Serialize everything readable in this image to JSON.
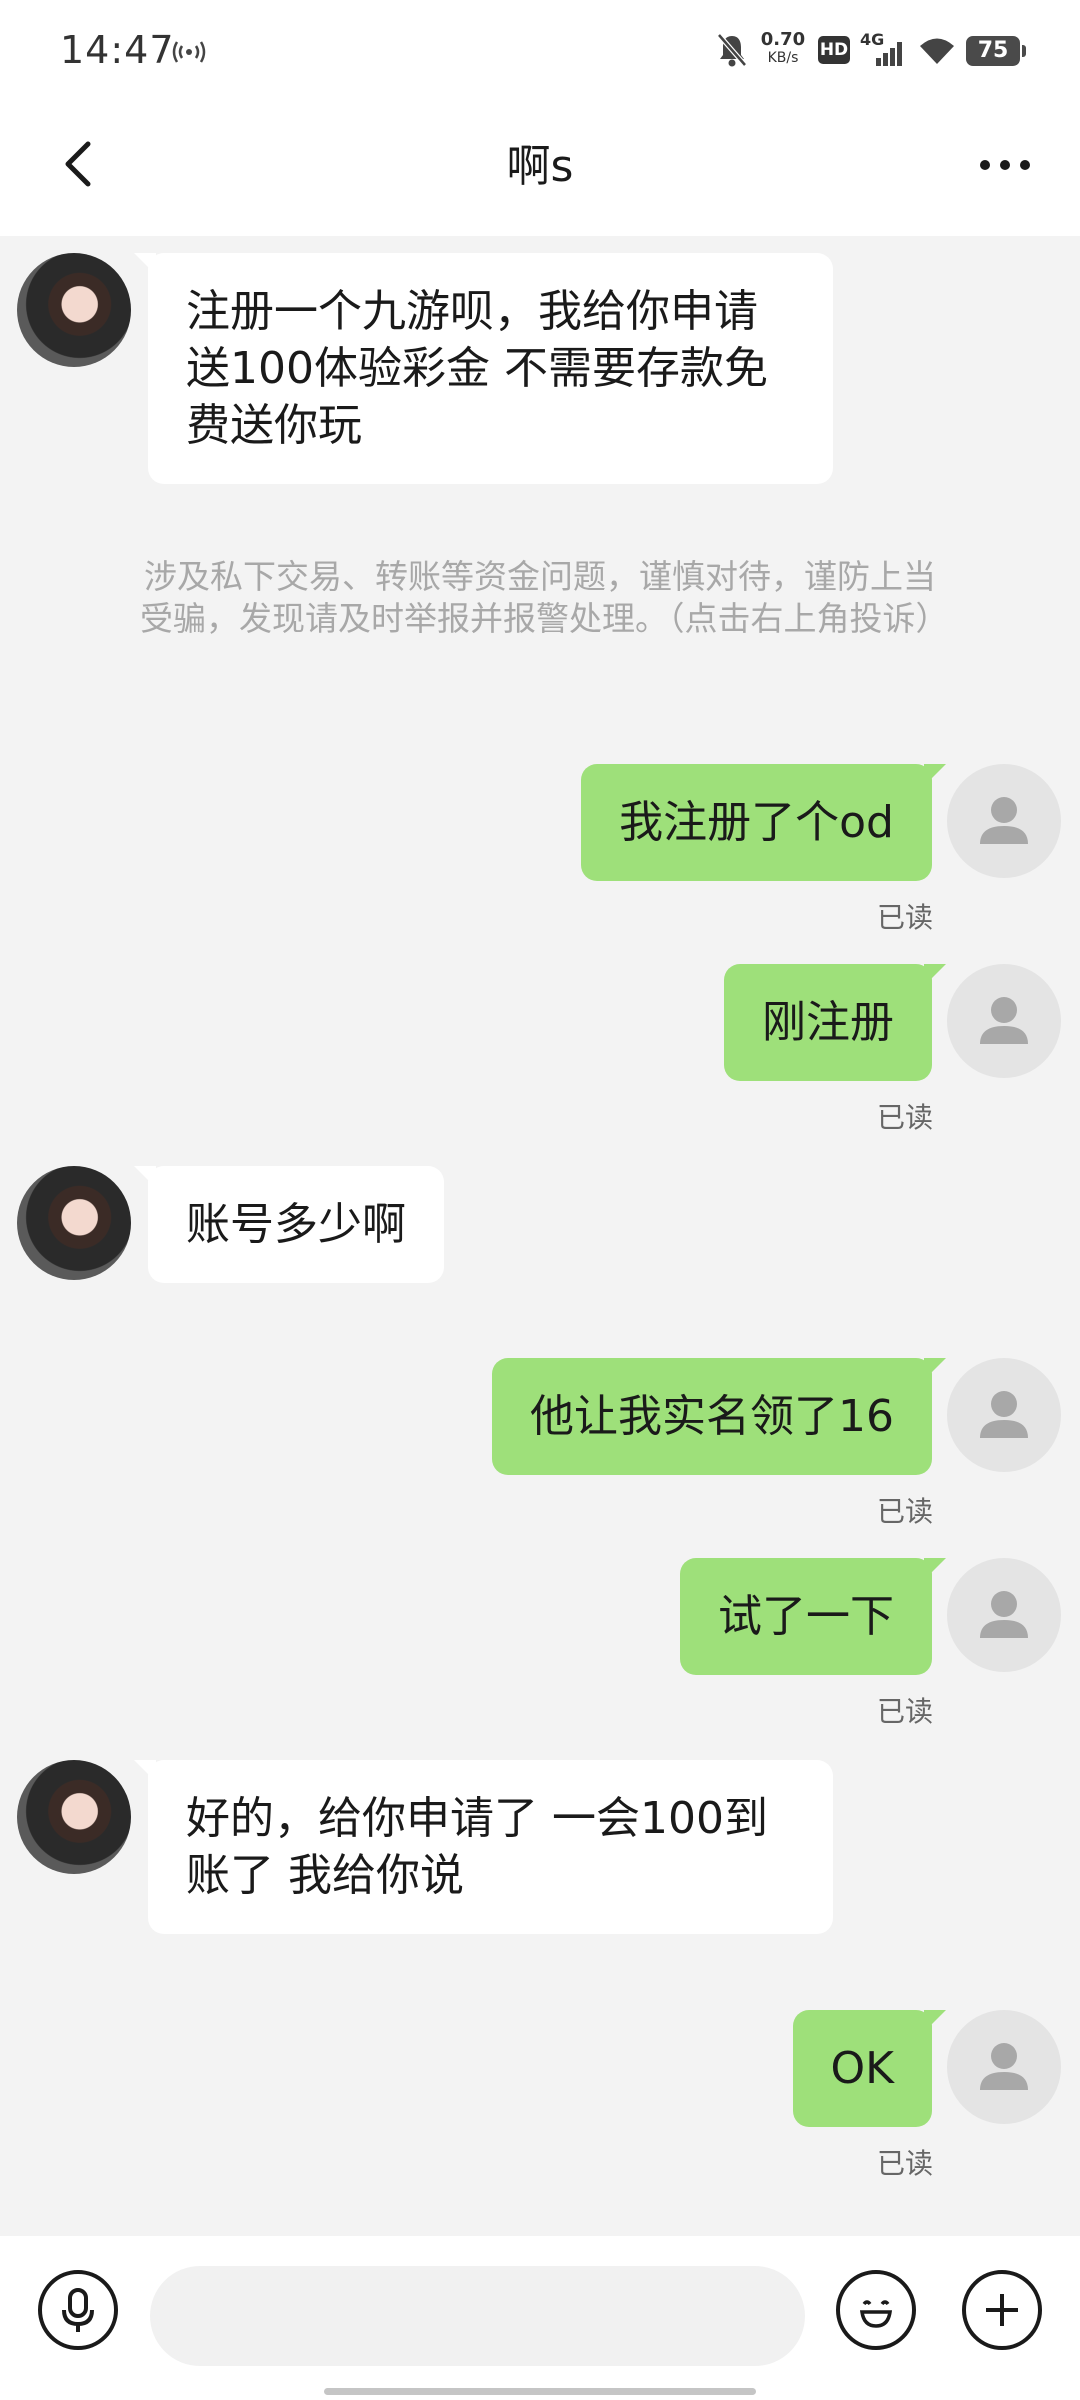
{
  "status_bar": {
    "time": "14:47",
    "net_speed_value": "0.70",
    "net_speed_unit": "KB/s",
    "hd_badge": "HD",
    "network": "4G",
    "battery": "75",
    "icons": [
      "signal-broadcast-icon",
      "mute-bell-icon",
      "hd-icon",
      "4g-signal-icon",
      "wifi-icon",
      "battery-icon"
    ]
  },
  "nav": {
    "title": "啊s",
    "back_icon": "chevron-left-icon",
    "more_icon": "more-horizontal-icon"
  },
  "messages": [
    {
      "side": "in",
      "text": "注册一个九游呗，我给你申请送100体验彩金 不需要存款免费送你玩"
    },
    {
      "side": "system",
      "text": "涉及私下交易、转账等资金问题，谨慎对待，谨防上当受骗，发现请及时举报并报警处理。（点击右上角投诉）"
    },
    {
      "side": "out",
      "text": "我注册了个od",
      "status": "已读"
    },
    {
      "side": "out",
      "text": "刚注册",
      "status": "已读"
    },
    {
      "side": "in",
      "text": "账号多少啊"
    },
    {
      "side": "out",
      "text": "他让我实名领了16",
      "status": "已读"
    },
    {
      "side": "out",
      "text": "试了一下",
      "status": "已读"
    },
    {
      "side": "in",
      "text": "好的，给你申请了 一会100到账了 我给你说"
    },
    {
      "side": "out",
      "text": "OK",
      "status": "已读"
    }
  ],
  "input_bar": {
    "voice_icon": "microphone-icon",
    "emoji_icon": "emoji-icon",
    "plus_icon": "plus-icon",
    "placeholder": ""
  },
  "colors": {
    "outgoing_bubble": "#9ee07a",
    "incoming_bubble": "#ffffff",
    "chat_background": "#f3f3f3"
  }
}
